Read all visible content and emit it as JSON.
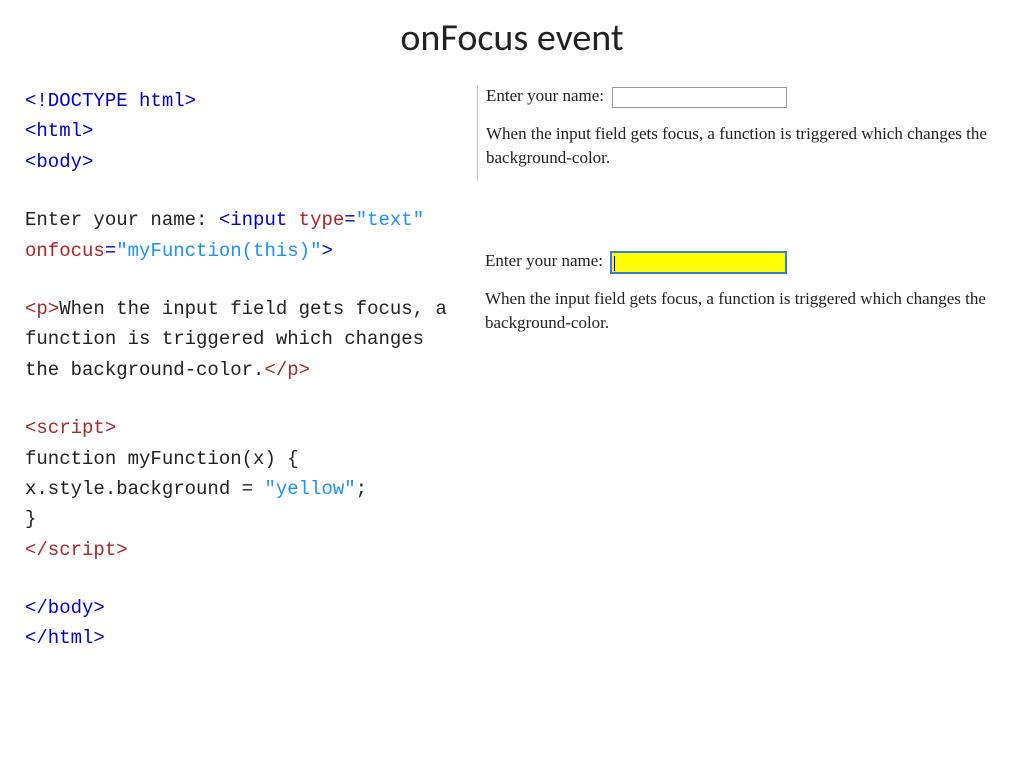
{
  "title": "onFocus event",
  "code": {
    "l01": "<!DOCTYPE html>",
    "l02": "<html>",
    "l03": "<body>",
    "l04a_text": "Enter your name: ",
    "l04b": "<input ",
    "l04c_attr": "type",
    "l04d_eq": "=",
    "l04e_val": "\"text\"",
    "l05a_attr": "onfocus",
    "l05b_eq": "=",
    "l05c_val": "\"myFunction(this)\"",
    "l05d": ">",
    "l06a": "<p>",
    "l06b_text": "When the input field gets focus, a function is triggered which changes the background-color.",
    "l06c": "</p>",
    "l07": "<script>",
    "l08": "function myFunction(x) {",
    "l09": "    x.style.background = ",
    "l09_val": "\"yellow\"",
    "l09_end": ";",
    "l10": "}",
    "l11": "</script>",
    "l12": "</body>",
    "l13": "</html>"
  },
  "output": {
    "label": "Enter your name:",
    "desc": "When the input field gets focus, a function is triggered which changes the background-color."
  }
}
